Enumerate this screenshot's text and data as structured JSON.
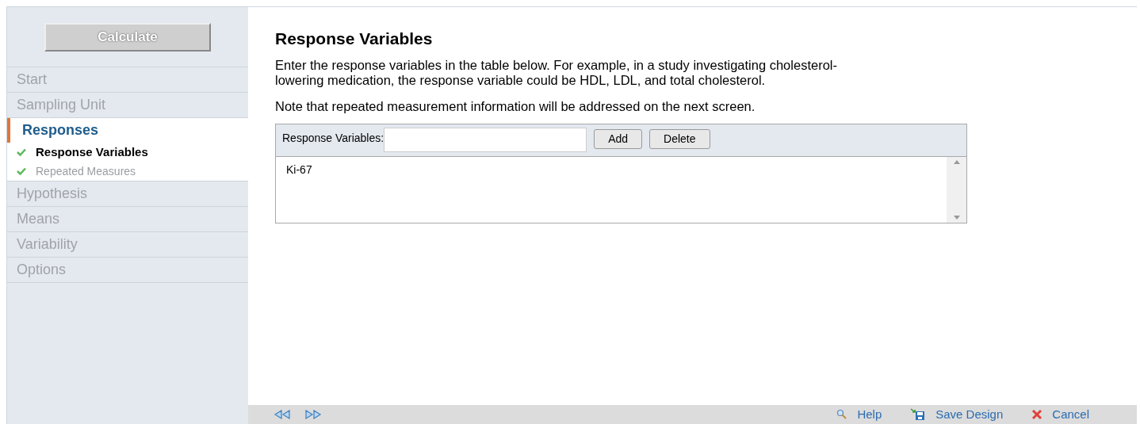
{
  "sidebar": {
    "calculate_button": "Calculate",
    "items": [
      {
        "label": "Start",
        "selected": false
      },
      {
        "label": "Sampling Unit",
        "selected": false
      },
      {
        "label": "Responses",
        "selected": true,
        "children": [
          {
            "label": "Response Variables",
            "selected": true,
            "checked": true
          },
          {
            "label": "Repeated Measures",
            "selected": false,
            "checked": true
          }
        ]
      },
      {
        "label": "Hypothesis",
        "selected": false
      },
      {
        "label": "Means",
        "selected": false
      },
      {
        "label": "Variability",
        "selected": false
      },
      {
        "label": "Options",
        "selected": false
      }
    ]
  },
  "main": {
    "title": "Response Variables",
    "paragraphs": [
      "Enter the response variables in the table below. For example, in a study investigating cholesterol-lowering medication, the response variable could be HDL, LDL, and total cholesterol.",
      "Note that repeated measurement information will be addressed on the next screen."
    ],
    "table": {
      "field_label": "Response Variables:",
      "buttons": [
        "Add",
        "Delete"
      ],
      "rows": [
        "Ki-67"
      ]
    }
  },
  "footer": {
    "links": [
      "Help",
      "Save Design",
      "Cancel"
    ]
  }
}
